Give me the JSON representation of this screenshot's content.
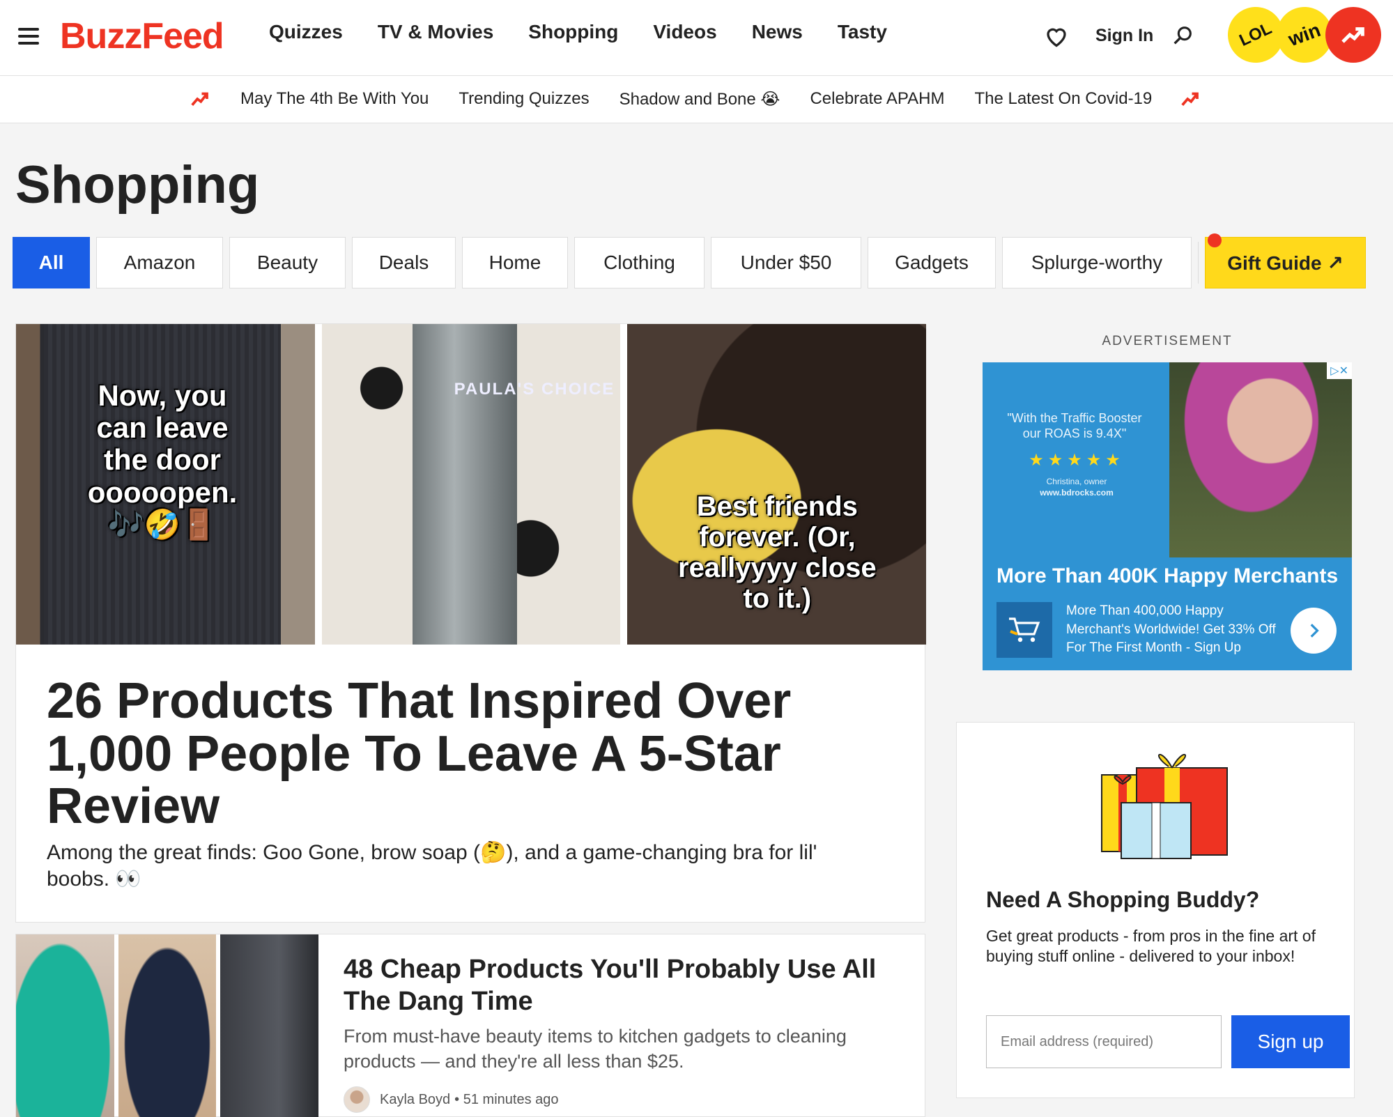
{
  "header": {
    "logo": "BuzzFeed",
    "nav": [
      "Quizzes",
      "TV & Movies",
      "Shopping",
      "Videos",
      "News",
      "Tasty"
    ],
    "signin": "Sign In",
    "badges": {
      "lol": "LOL",
      "win": "win"
    },
    "icons": [
      "hamburger-icon",
      "heart-icon",
      "search-icon",
      "trending-icon"
    ]
  },
  "trending": {
    "links": [
      "May The 4th Be With You",
      "Trending Quizzes",
      "Shadow and Bone 😭",
      "Celebrate APAHM",
      "The Latest On Covid-19"
    ]
  },
  "page": {
    "title": "Shopping",
    "filters": [
      "All",
      "Amazon",
      "Beauty",
      "Deals",
      "Home",
      "Clothing",
      "Under $50",
      "Gadgets",
      "Splurge-worthy"
    ],
    "gift_guide": "Gift Guide ↗"
  },
  "feature": {
    "image_text_1": "Now, you can leave the door ooooopen. 🎶🤣🚪",
    "image_text_2": "PAULA'S CHOICE",
    "image_text_3": "Best friends forever. (Or, reallyyyy close to it.)",
    "title": "26 Products That Inspired Over 1,000 People To Leave A 5-Star Review",
    "desc": "Among the great finds: Goo Gone, brow soap (🤔), and a game-changing bra for lil' boobs. 👀"
  },
  "card2": {
    "title": "48 Cheap Products You'll Probably Use All The Dang Time",
    "desc": "From must-have beauty items to kitchen gadgets to cleaning products — and they're all less than $25.",
    "author": "Kayla Boyd",
    "time": "• 51 minutes ago"
  },
  "ad": {
    "label": "ADVERTISEMENT",
    "quote": "\"With the Traffic Booster our ROAS is 9.4X\"",
    "stars": "★★★★★",
    "attrib_name": "Christina, owner",
    "attrib_url": "www.bdrocks.com",
    "headline": "More Than 400K Happy Merchants",
    "body": "More Than 400,000 Happy Merchant's Worldwide! Get 33% Off For The First Month - Sign Up"
  },
  "newsletter": {
    "title": "Need A Shopping Buddy?",
    "desc": "Get great products - from pros in the fine art of buying stuff online - delivered to your inbox!",
    "placeholder": "Email address (required)",
    "button": "Sign up"
  },
  "colors": {
    "brand": "#ee3322",
    "accent": "#1a5ee6",
    "gift": "#ffd91b"
  }
}
